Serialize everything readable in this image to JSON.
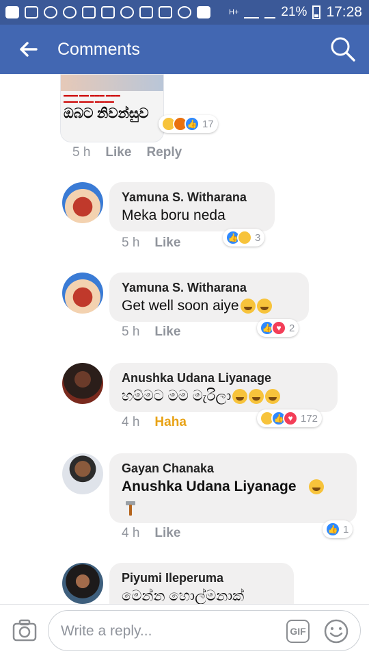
{
  "status_bar": {
    "battery": "21%",
    "time": "17:28"
  },
  "app_bar": {
    "title": "Comments",
    "back_icon": "arrow-left-icon",
    "search_icon": "search-icon"
  },
  "post": {
    "image_caption": "ඔබට නිවන්සුව",
    "time": "5 h",
    "like_label": "Like",
    "reply_label": "Reply",
    "reactions": {
      "types": [
        "haha",
        "angry",
        "like"
      ],
      "count": "17"
    }
  },
  "comments": [
    {
      "name": "Yamuna S. Witharana",
      "text": "Meka boru neda",
      "time": "5 h",
      "action": "Like",
      "reactions": {
        "types": [
          "like",
          "haha"
        ],
        "count": "3"
      }
    },
    {
      "name": "Yamuna S. Witharana",
      "text": "Get well soon aiye",
      "time": "5 h",
      "action": "Like",
      "reactions": {
        "types": [
          "like",
          "love"
        ],
        "count": "2"
      }
    },
    {
      "name": "Anushka Udana Liyanage",
      "text": "හම්මට මම මැරිලා",
      "time": "4 h",
      "action": "Haha",
      "reactions": {
        "types": [
          "haha",
          "like",
          "love"
        ],
        "count": "172"
      }
    },
    {
      "name": "Gayan Chanaka",
      "text": "Anushka Udana Liyanage",
      "time": "4 h",
      "action": "Like",
      "reactions": {
        "types": [
          "like"
        ],
        "count": "1"
      }
    },
    {
      "name": "Piyumi Ileperuma",
      "text": "මෙන්න හොල්මනාක්"
    }
  ],
  "composer": {
    "placeholder": "Write a reply...",
    "gif_label": "GIF"
  },
  "colors": {
    "status_bar": "#3b5998",
    "app_bar": "#4267b2",
    "like_blue": "#2e89ff",
    "haha_orange": "#e8a317"
  }
}
